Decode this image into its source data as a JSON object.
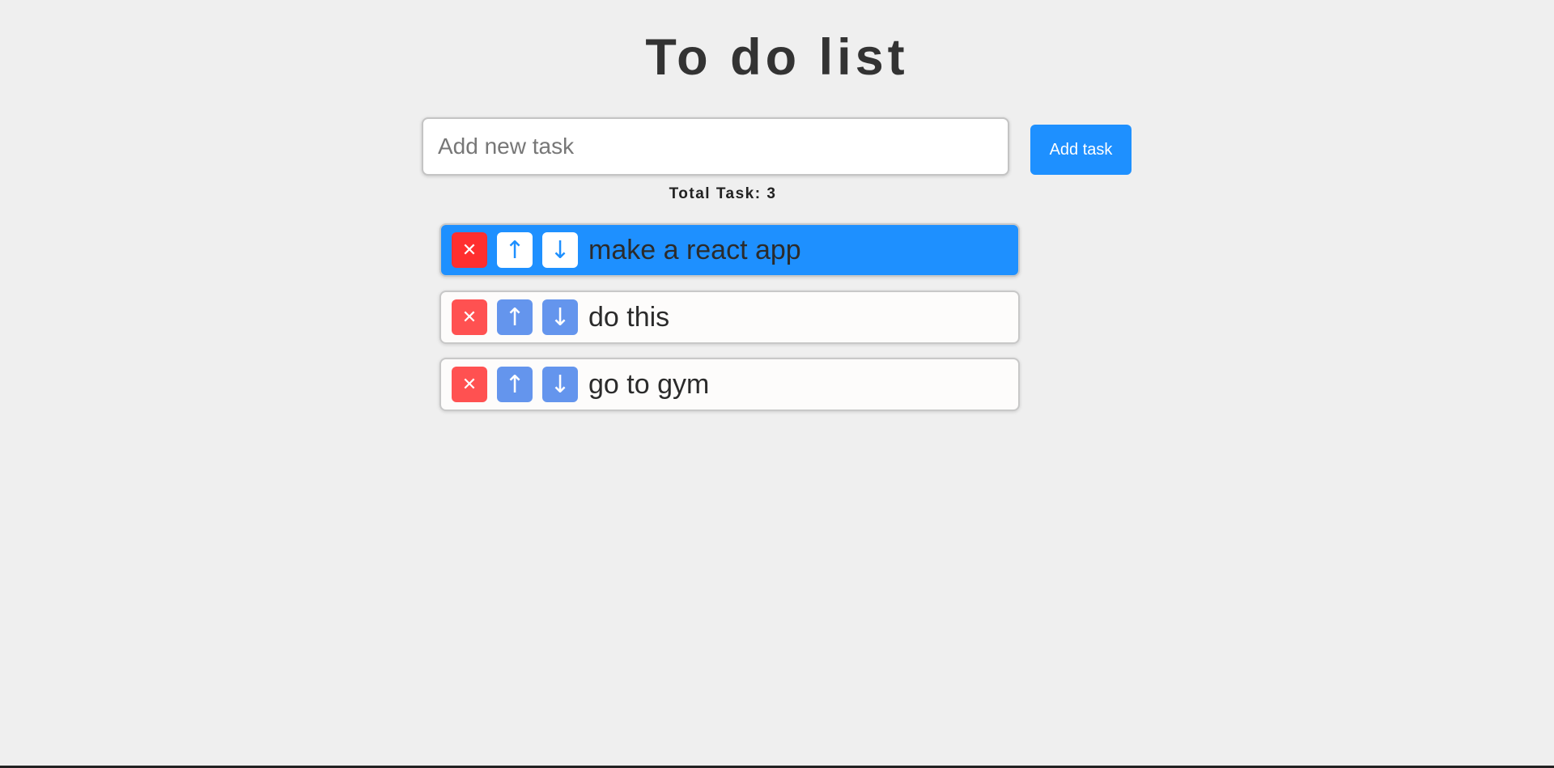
{
  "header": {
    "title": "To do list"
  },
  "form": {
    "placeholder": "Add new task",
    "value": "",
    "add_label": "Add task"
  },
  "total_label": "Total Task: 3",
  "icons": {
    "delete": "close-icon",
    "up": "arrow-up-icon",
    "down": "arrow-down-icon"
  },
  "glyphs": {
    "delete": "✕",
    "up": "↑",
    "down": "↓"
  },
  "colors": {
    "accent": "#1e90ff",
    "delete": "#ff5151",
    "move": "#6495ed",
    "background": "#efefef",
    "title": "#333333"
  },
  "tasks": [
    {
      "text": "make a react app",
      "selected": true
    },
    {
      "text": "do this",
      "selected": false
    },
    {
      "text": "go to gym",
      "selected": false
    }
  ]
}
